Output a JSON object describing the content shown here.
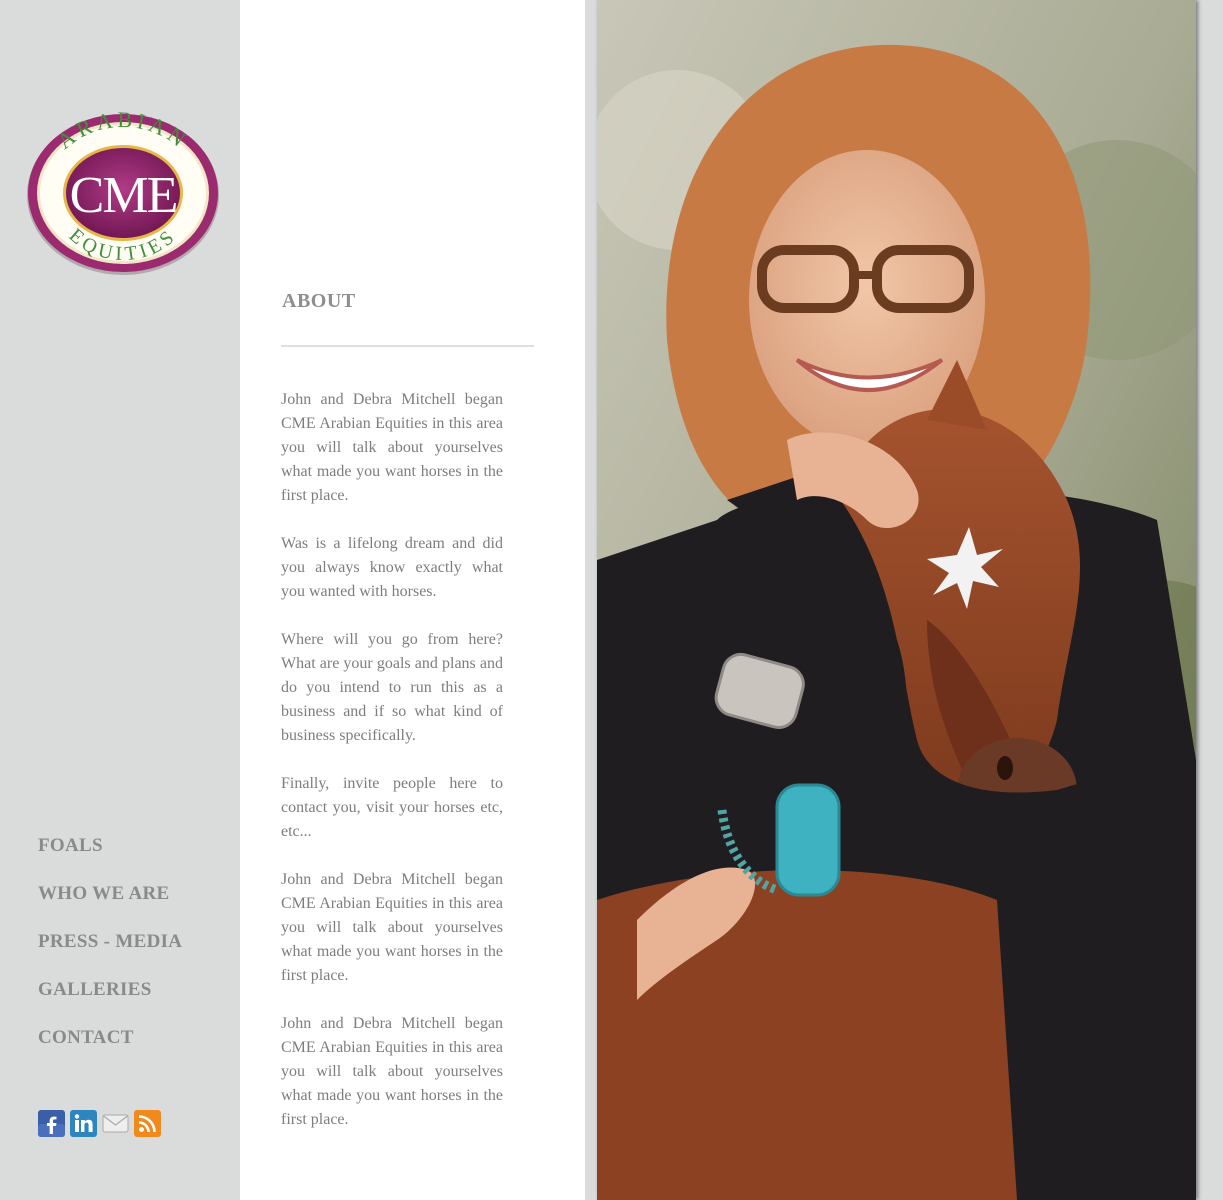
{
  "brand": {
    "logo_top": "ARABIAN",
    "logo_center": "CME",
    "logo_bottom": "EQUITIES"
  },
  "nav": {
    "items": [
      {
        "label": "FOALS"
      },
      {
        "label": "WHO WE ARE"
      },
      {
        "label": "PRESS - MEDIA"
      },
      {
        "label": "GALLERIES"
      },
      {
        "label": "CONTACT"
      }
    ]
  },
  "social": {
    "icons": [
      "facebook-icon",
      "linkedin-icon",
      "email-icon",
      "rss-icon"
    ]
  },
  "about": {
    "title": "ABOUT",
    "paragraphs": [
      "John and Debra Mitchell began CME Arabian Equities in this area you will talk about yourselves what made you want horses in the first place.",
      "Was is a lifelong dream and did you always know exactly what you wanted with horses.",
      "Where will you go from here? What are your goals and plans and do you intend to run this as a business and if so what kind of business specifically.",
      "Finally, invite people here to contact you, visit your horses etc, etc...",
      "John and Debra Mitchell began CME Arabian Equities in this area you will talk about yourselves what made you want horses in the first place.",
      "John and Debra Mitchell began CME Arabian Equities in this area you will talk about yourselves what made you want horses in the first place."
    ]
  },
  "colors": {
    "sidebar_bg": "#d9dcdb",
    "content_bg": "#ffffff",
    "text": "#7d7d7d",
    "logo_purple": "#8a1f63",
    "logo_green": "#3f8f3a"
  }
}
